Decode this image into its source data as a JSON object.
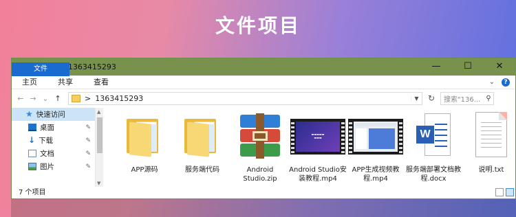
{
  "banner": {
    "title": "文件项目"
  },
  "window": {
    "title": "1363415293",
    "min_glyph": "—",
    "max_glyph": "☐",
    "close_glyph": "✕"
  },
  "ribbon": {
    "tabs": [
      "文件",
      "主页",
      "共享",
      "查看"
    ],
    "expand_glyph": "⌄",
    "help_glyph": "?"
  },
  "addressbar": {
    "back_glyph": "←",
    "forward_glyph": "→",
    "recent_glyph": "⌄",
    "up_glyph": "↑",
    "separator": ">",
    "path": "1363415293",
    "chevron": "▼",
    "refresh_glyph": "↻",
    "search_placeholder": "搜索\"136...",
    "search_glyph": "⚲"
  },
  "nav_pane": {
    "items": [
      {
        "label": "快速访问",
        "icon": "star-icon"
      },
      {
        "label": "桌面",
        "icon": "desktop-icon"
      },
      {
        "label": "下载",
        "icon": "download-icon"
      },
      {
        "label": "文档",
        "icon": "document-icon"
      },
      {
        "label": "图片",
        "icon": "pictures-icon"
      }
    ],
    "pin_glyph": "📌"
  },
  "files": [
    {
      "name": "APP源码",
      "type": "folder"
    },
    {
      "name": "服务端代码",
      "type": "folder"
    },
    {
      "name": "Android Studio.zip",
      "type": "zip"
    },
    {
      "name": "Android Studio安装教程.mp4",
      "type": "video"
    },
    {
      "name": "APP生成视频教程.mp4",
      "type": "video"
    },
    {
      "name": "服务端部署文档教程.docx",
      "type": "docx"
    },
    {
      "name": "说明.txt",
      "type": "txt"
    }
  ],
  "statusbar": {
    "count_text": "7 个项目"
  },
  "accent_color": "#1a6bd0",
  "titlebar_color": "#78924d"
}
